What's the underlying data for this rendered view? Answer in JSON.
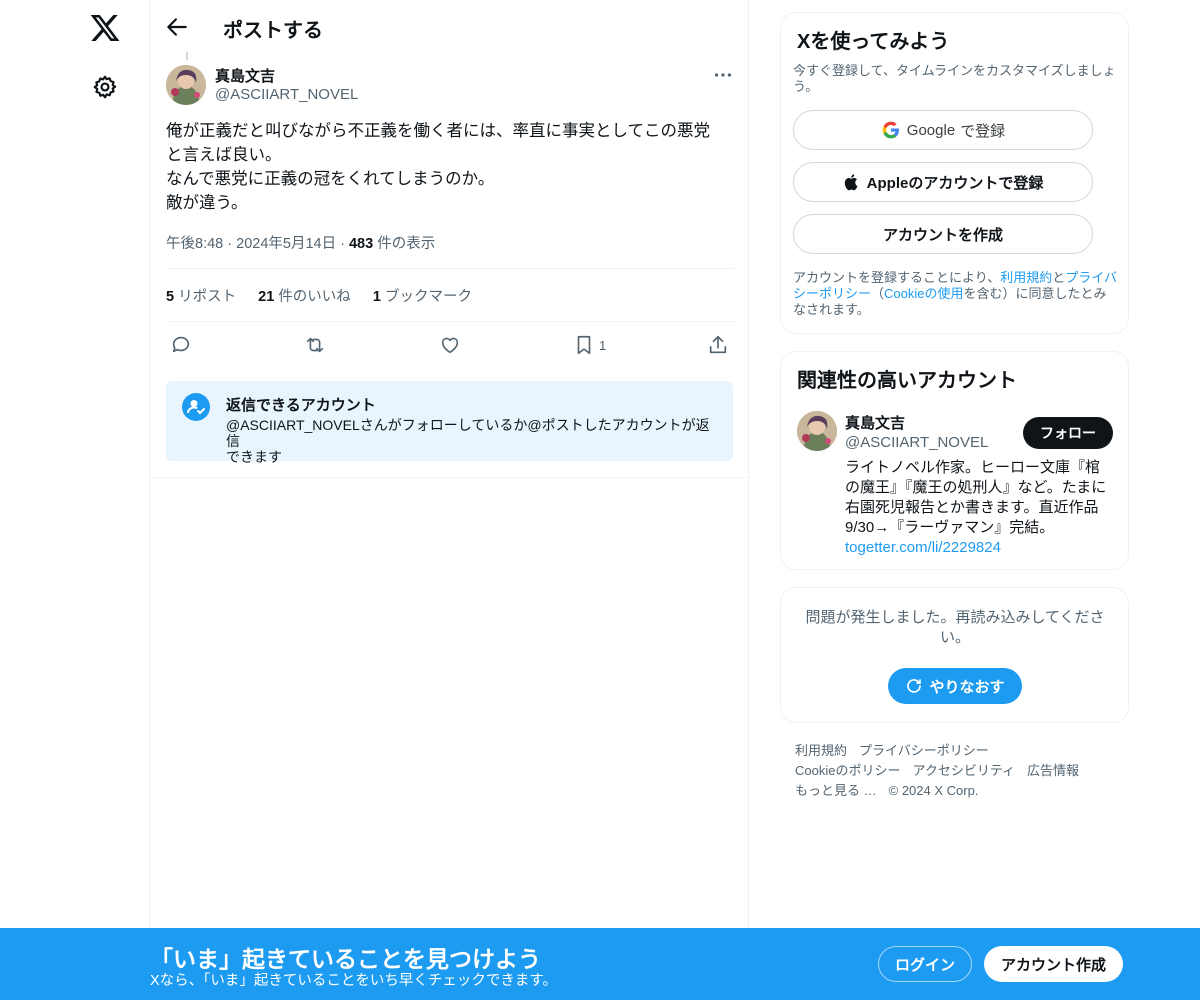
{
  "header": {
    "title": "ポストする"
  },
  "post": {
    "author_name": "真島文吉",
    "author_handle": "@ASCIIART_NOVEL",
    "text": "俺が正義だと叫びながら不正義を働く者には、率直に事実としてこの悪党\nと言えば良い。\nなんで悪党に正義の冠をくれてしまうのか。\n敵が違う。",
    "time": "午後8:48",
    "date": "2024年5月14日",
    "views_count": "483",
    "views_label": "件の表示",
    "stats": {
      "reposts_count": "5",
      "reposts_label": "リポスト",
      "likes_count": "21",
      "likes_label": "件のいいね",
      "bookmarks_count": "1",
      "bookmarks_label": "ブックマーク"
    },
    "actions": {
      "bookmark_count": "1"
    }
  },
  "reply_restriction": {
    "title": "返信できるアカウント",
    "description": "@ASCIIART_NOVELさんがフォローしているか@ポストしたアカウントが返信\nできます"
  },
  "signup_card": {
    "title": "Xを使ってみよう",
    "subtitle": "今すぐ登録して、タイムラインをカスタマイズしましょう。",
    "google_label": "Google",
    "google_suffix": "で登録",
    "apple_label": "Appleのアカウントで登録",
    "create_label": "アカウントを作成",
    "terms_prefix": "アカウントを登録することにより、",
    "terms_link": "利用規約",
    "terms_and": "と",
    "privacy_link": "プライバシーポリシー",
    "terms_paren_open": "（",
    "cookie_link": "Cookieの使用",
    "terms_suffix": "を含む）に同意したとみなされます。"
  },
  "related": {
    "title": "関連性の高いアカウント",
    "name": "真島文吉",
    "handle": "@ASCIIART_NOVEL",
    "follow_label": "フォロー",
    "bio": "ライトノベル作家。ヒーロー文庫『棺の魔王』『魔王の処刑人』など。たまに右園死児報告とか書きます。直近作品9/30→『ラーヴァマン』完結。",
    "link": "togetter.com/li/2229824"
  },
  "error_card": {
    "message": "問題が発生しました。再読み込みしてください。",
    "retry_label": "やりなおす"
  },
  "footer": {
    "terms": "利用規約",
    "privacy": "プライバシーポリシー",
    "cookie": "Cookieのポリシー",
    "accessibility": "アクセシビリティ",
    "ads": "広告情報",
    "more": "もっと見る …",
    "copyright": "© 2024 X Corp."
  },
  "banner": {
    "title": "「いま」起きていることを見つけよう",
    "subtitle": "Xなら、「いま」起きていることをいち早くチェックできます。",
    "login_label": "ログイン",
    "signup_label": "アカウント作成"
  },
  "colors": {
    "accent": "#1d9bf0",
    "text": "#0f1419",
    "secondary_text": "#536471",
    "border": "#eff3f4",
    "reply_box_bg": "#e8f5fd"
  },
  "icons": [
    "x-logo-icon",
    "gear-icon",
    "back-arrow-icon",
    "more-icon",
    "reply-icon",
    "repost-icon",
    "like-icon",
    "bookmark-icon",
    "share-icon",
    "reply-permission-icon",
    "google-icon",
    "apple-icon",
    "refresh-icon"
  ]
}
